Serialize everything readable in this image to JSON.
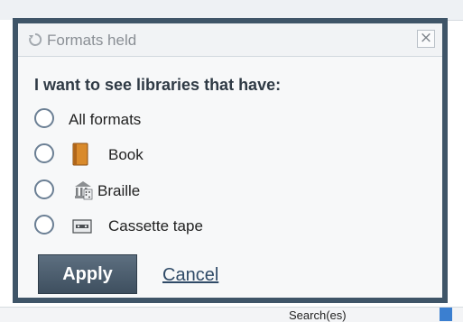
{
  "dialog": {
    "title": "Formats held",
    "close_glyph": "×",
    "heading": "I want to see libraries that have:",
    "options": [
      {
        "label": "All formats",
        "icon": "none"
      },
      {
        "label": "Book",
        "icon": "book-icon"
      },
      {
        "label": "Braille",
        "icon": "braille-icon"
      },
      {
        "label": "Cassette tape",
        "icon": "cassette-icon"
      }
    ],
    "apply_label": "Apply",
    "cancel_label": "Cancel"
  },
  "background": {
    "bottom_text": "Search(es)"
  }
}
